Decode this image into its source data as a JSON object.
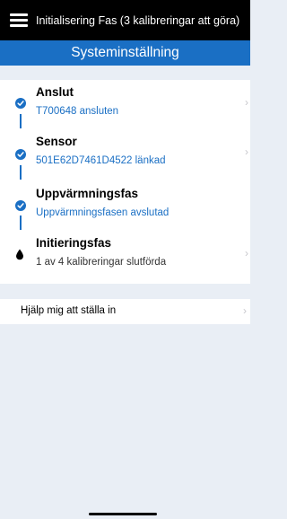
{
  "topbar": {
    "title": "Initialisering Fas (3 kalibreringar att göra)"
  },
  "navbar": {
    "title": "Systeminställning"
  },
  "steps": [
    {
      "title": "Anslut",
      "subtitle": "T700648 ansluten",
      "status": "completed",
      "icon": "check-circle-icon"
    },
    {
      "title": "Sensor",
      "subtitle": "501E62D7461D4522 länkad",
      "status": "completed",
      "icon": "check-circle-icon"
    },
    {
      "title": "Uppvärmningsfas",
      "subtitle": "Uppvärmningsfasen avslutad",
      "status": "completed",
      "icon": "check-circle-icon"
    },
    {
      "title": "Initieringsfas",
      "subtitle": "1 av 4 kalibreringar slutförda",
      "status": "in-progress",
      "icon": "blood-drop-icon"
    }
  ],
  "help": {
    "label": "Hjälp mig att ställa in"
  },
  "colors": {
    "accent": "#1a6fc4",
    "topbar": "#000000",
    "background": "#e9eef5"
  }
}
